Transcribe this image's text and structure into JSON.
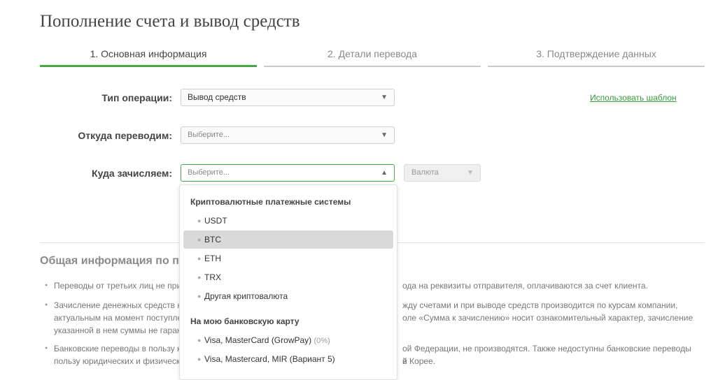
{
  "page": {
    "title": "Пополнение счета и вывод средств"
  },
  "steps": [
    {
      "label": "1. Основная информация",
      "active": true
    },
    {
      "label": "2. Детали перевода",
      "active": false
    },
    {
      "label": "3. Подтверждение данных",
      "active": false
    }
  ],
  "form": {
    "operation_type": {
      "label": "Тип операции:",
      "value": "Вывод средств"
    },
    "from": {
      "label": "Откуда переводим:",
      "placeholder": "Выберите..."
    },
    "to": {
      "label": "Куда зачисляем:",
      "placeholder": "Выберите..."
    },
    "currency": {
      "placeholder": "Валюта"
    },
    "use_template": "Использовать шаблон"
  },
  "dropdown": {
    "groups": [
      {
        "title": "Криптовалютные платежные системы",
        "options": [
          {
            "label": "USDT"
          },
          {
            "label": "BTC",
            "hover": true
          },
          {
            "label": "ETH"
          },
          {
            "label": "TRX"
          },
          {
            "label": "Другая криптовалюта"
          }
        ]
      },
      {
        "title": "На мою банковскую карту",
        "options": [
          {
            "label": "Visa, MasterCard (GrowPay)",
            "note": "(0%)"
          },
          {
            "label": "Visa, Mastercard, MIR (Вариант 5)"
          }
        ]
      }
    ]
  },
  "info": {
    "title": "Общая информация по п",
    "bullets": [
      {
        "left": "Переводы от третьих лиц не при",
        "right": "ода на реквизиты отправителя, оплачиваются за счет клиента."
      },
      {
        "left": "Зачисление денежных средств н",
        "right": "жду счетами и при выводе средств производится по курсам компании,",
        "left2": "актуальным на момент поступле",
        "right2": "оле «Сумма к зачислению» носит ознакомительный характер, зачисление",
        "left3": "указанной в нем суммы не гаран"
      },
      {
        "left": "Банковские переводы в пользу к",
        "right": "ой Федерации, не производятся. Также недоступны банковские переводы в",
        "left2": "пользу юридических и физическ",
        "right2": "й Корее."
      }
    ]
  },
  "icons": {
    "arrow_down": "▼",
    "arrow_up": "▲",
    "bullet": "●"
  },
  "colors": {
    "accent": "#49a846",
    "link": "#3a9a3a"
  }
}
